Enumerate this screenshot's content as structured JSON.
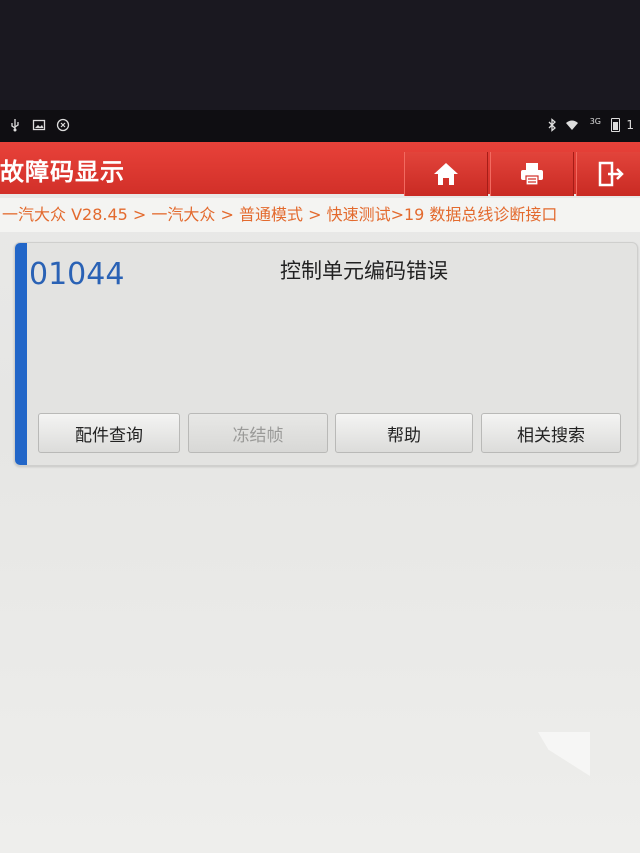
{
  "status_bar": {
    "left_icons": [
      "usb-icon",
      "image-icon",
      "app-icon"
    ],
    "right_icons": [
      "bluetooth-icon",
      "wifi-icon",
      "signal-icon",
      "battery-icon"
    ],
    "network_label": "3G",
    "time_partial": "1"
  },
  "header": {
    "title": "故障码显示",
    "buttons": [
      "home-icon",
      "print-icon",
      "exit-icon"
    ],
    "color": "#d93a31"
  },
  "breadcrumb": {
    "text": "一汽大众 V28.45 > 一汽大众 > 普通模式 > 快速测试>19 数据总线诊断接口",
    "color": "#e36a2e"
  },
  "fault": {
    "code": "01044",
    "description": "控制单元编码错误",
    "accent_color": "#2266c8",
    "buttons": {
      "parts": "配件查询",
      "freeze_frame": "冻结帧",
      "help": "帮助",
      "search": "相关搜索"
    }
  }
}
